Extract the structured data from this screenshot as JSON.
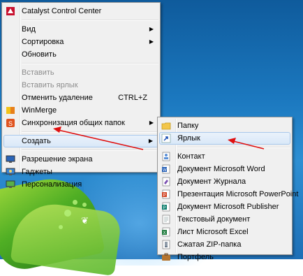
{
  "context_menu": {
    "items": [
      {
        "label": "Catalyst Control Center",
        "icon": "catalyst-icon"
      },
      {
        "label": "Вид",
        "submenu": true
      },
      {
        "label": "Сортировка",
        "submenu": true
      },
      {
        "label": "Обновить"
      },
      {
        "label": "Вставить",
        "disabled": true
      },
      {
        "label": "Вставить ярлык",
        "disabled": true
      },
      {
        "label": "Отменить удаление",
        "shortcut": "CTRL+Z"
      },
      {
        "label": "WinMerge",
        "icon": "winmerge-icon"
      },
      {
        "label": "Синхронизация общих папок",
        "submenu": true,
        "icon": "sync-icon"
      },
      {
        "label": "Создать",
        "submenu": true,
        "highlighted": true
      },
      {
        "label": "Разрешение экрана",
        "icon": "display-icon"
      },
      {
        "label": "Гаджеты",
        "icon": "gadgets-icon"
      },
      {
        "label": "Персонализация",
        "icon": "personalize-icon"
      }
    ]
  },
  "submenu": {
    "items": [
      {
        "label": "Папку",
        "icon": "folder-icon"
      },
      {
        "label": "Ярлык",
        "icon": "shortcut-icon",
        "highlighted": true
      },
      {
        "label": "Контакт",
        "icon": "contact-icon"
      },
      {
        "label": "Документ Microsoft Word",
        "icon": "word-icon"
      },
      {
        "label": "Документ Журнала",
        "icon": "journal-icon"
      },
      {
        "label": "Презентация Microsoft PowerPoint",
        "icon": "powerpoint-icon"
      },
      {
        "label": "Документ Microsoft Publisher",
        "icon": "publisher-icon"
      },
      {
        "label": "Текстовый документ",
        "icon": "text-document-icon"
      },
      {
        "label": "Лист Microsoft Excel",
        "icon": "excel-icon"
      },
      {
        "label": "Сжатая ZIP-папка",
        "icon": "zip-folder-icon"
      },
      {
        "label": "Портфель",
        "icon": "briefcase-icon"
      }
    ]
  },
  "annotation_color": "#e01010"
}
